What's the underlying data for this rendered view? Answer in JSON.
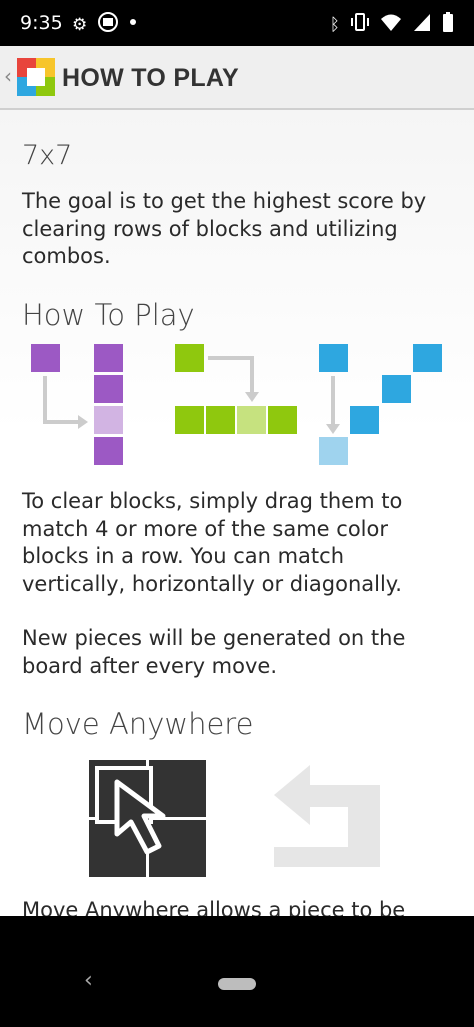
{
  "status_bar": {
    "time": "9:35",
    "left_icons": [
      "settings-icon",
      "sim-icon",
      "dot-icon"
    ],
    "right_icons": [
      "bluetooth-icon",
      "vibrate-icon",
      "wifi-icon",
      "signal-icon",
      "battery-icon"
    ]
  },
  "app_bar": {
    "title": "HOW TO PLAY"
  },
  "content": {
    "mode_heading": "7x7",
    "goal_text": "The goal is to get the highest score by clearing rows of blocks and utilizing combos.",
    "how_heading": "How To Play",
    "clear_text": "To clear blocks, simply drag them to match 4 or more of the same color blocks in a row. You can match vertically, horizontally or diagonally.",
    "new_pieces_text": "New pieces will be generated on the board after every move.",
    "move_heading": "Move Anywhere",
    "move_text_partial": "Move Anywhere allows a piece to be"
  },
  "colors": {
    "purple": "#9c59c4",
    "purple_light": "#d2b4e3",
    "green": "#8fc80e",
    "green_light": "#c6e27f",
    "blue": "#2ea7e0",
    "blue_light": "#9fd3ee",
    "dark_icon": "#333333",
    "light_icon": "#e6e6e6"
  }
}
